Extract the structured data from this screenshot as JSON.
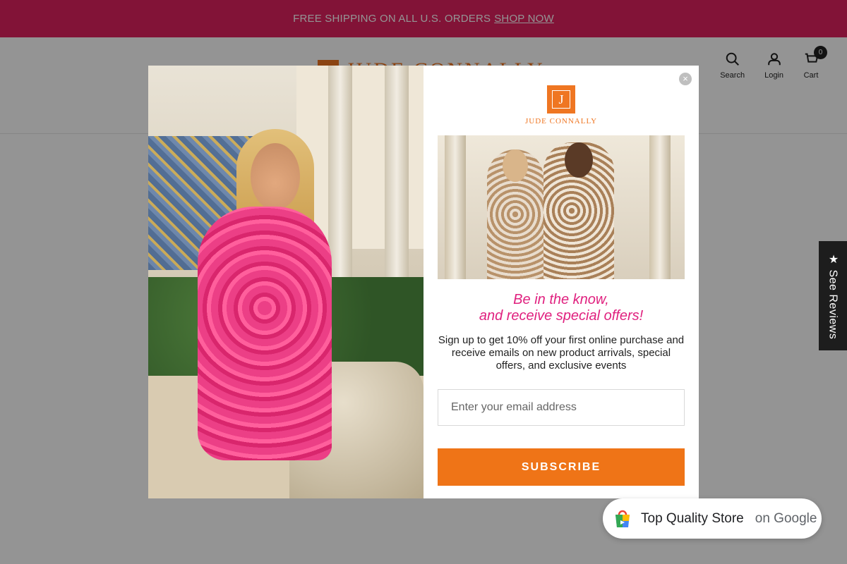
{
  "announcement": {
    "text": "FREE SHIPPING ON ALL U.S. ORDERS",
    "link": "SHOP NOW"
  },
  "header": {
    "brand": "JUDE CONNALLY",
    "search_label": "Search",
    "login_label": "Login",
    "cart_label": "Cart",
    "cart_count": "0"
  },
  "reviews_tab": {
    "label": "★ See Reviews"
  },
  "modal": {
    "close_glyph": "×",
    "brand_mark": "J",
    "brand_name": "JUDE CONNALLY",
    "headline_line1": "Be in the know,",
    "headline_line2": "and receive special offers!",
    "description": "Sign up to get 10% off your first online purchase and receive emails on new product arrivals, special offers, and exclusive events",
    "email_placeholder": "Enter your email address",
    "subscribe_label": "SUBSCRIBE"
  },
  "google_badge": {
    "title": "Top Quality Store",
    "suffix": "on Google"
  },
  "colors": {
    "announce_bg": "#e0215f",
    "brand_orange": "#ef7622",
    "headline_pink": "#e0217f",
    "subscribe_bg": "#ef7417"
  },
  "icons": [
    "search-icon",
    "user-icon",
    "cart-icon",
    "close-icon",
    "google-shopping-bag-icon"
  ]
}
